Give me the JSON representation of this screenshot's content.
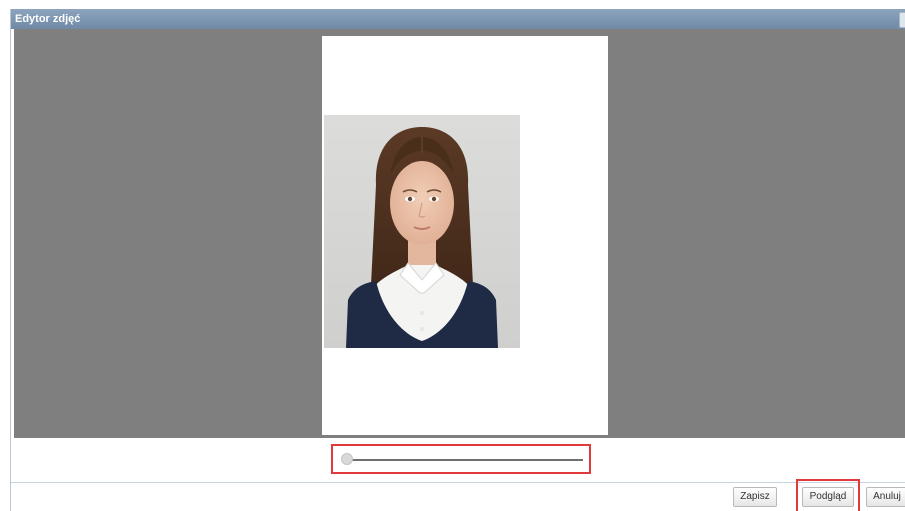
{
  "window": {
    "title": "Edytor zdjęć"
  },
  "editor": {
    "photo_alt": "Portrait photo of a girl with long brown hair in a white collared shirt and navy vest"
  },
  "zoom_slider": {
    "value": 0.0
  },
  "buttons": {
    "save": "Zapisz",
    "preview": "Podgląd",
    "cancel": "Anuluj"
  },
  "colors": {
    "titlebar": "#7b93ad",
    "canvas": "#7f7f7f",
    "highlight": "#e23a3a"
  }
}
